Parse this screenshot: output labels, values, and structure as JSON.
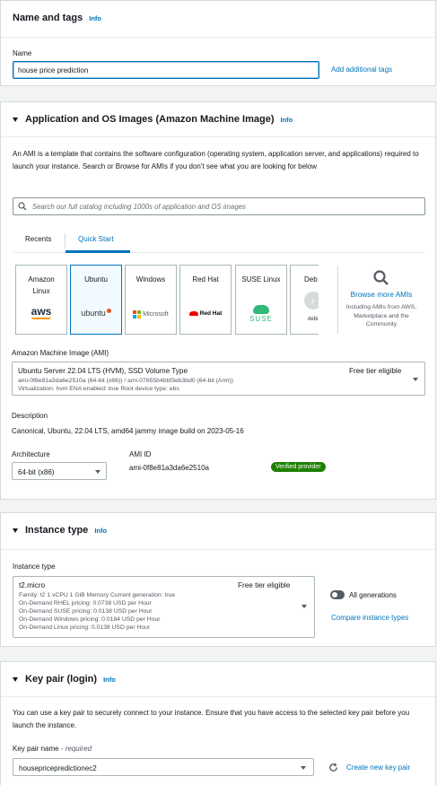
{
  "name_tags": {
    "title": "Name and tags",
    "info": "Info",
    "name_label": "Name",
    "name_value": "house price prediction",
    "add_tags_link": "Add additional tags"
  },
  "app_os": {
    "title": "Application and OS Images (Amazon Machine Image)",
    "info": "Info",
    "description": "An AMI is a template that contains the software configuration (operating system, application server, and applications) required to launch your instance. Search or Browse for AMIs if you don't see what you are looking for below",
    "search_placeholder": "Search our full catalog including 1000s of application and OS images",
    "tabs": [
      "Recents",
      "Quick Start"
    ],
    "cards": [
      {
        "name": "Amazon Linux",
        "logo": "aws"
      },
      {
        "name": "Ubuntu",
        "logo": "ubuntu"
      },
      {
        "name": "Windows",
        "logo": "Microsoft"
      },
      {
        "name": "Red Hat",
        "logo": "Red Hat"
      },
      {
        "name": "SUSE Linux",
        "logo": "SUSE"
      },
      {
        "name": "Deb",
        "logo": "debi"
      }
    ],
    "browse_more": "Browse more AMIs",
    "browse_sub": "Including AMIs from AWS, Marketplace and the Community",
    "ami_label": "Amazon Machine Image (AMI)",
    "ami_name": "Ubuntu Server 22.04 LTS (HVM), SSD Volume Type",
    "ami_ids": "ami-0f8e81a3da6e2510a (64-bit (x86)) / ami-07655b4bbf3eb3bd0 (64-bit (Arm))",
    "ami_meta": "Virtualization: hvm    ENA enabled: true    Root device type: ebs",
    "free_tier": "Free tier eligible",
    "desc_label": "Description",
    "desc_value": "Canonical, Ubuntu, 22.04 LTS, amd64 jammy image build on 2023-05-16",
    "arch_label": "Architecture",
    "arch_value": "64-bit (x86)",
    "ami_id_label": "AMI ID",
    "ami_id_value": "ami-0f8e81a3da6e2510a",
    "verified": "Verified provider"
  },
  "instance": {
    "title": "Instance type",
    "info": "Info",
    "label": "Instance type",
    "type": "t2.micro",
    "free_tier": "Free tier eligible",
    "family": "Family: t2    1 vCPU    1 GiB Memory    Current generation: true",
    "rhel": "On-Demand RHEL pricing: 0.0738 USD per Hour",
    "suse": "On-Demand SUSE pricing: 0.0138 USD per Hour",
    "windows": "On-Demand Windows pricing: 0.0184 USD per Hour",
    "linux": "On-Demand Linux pricing: 0.0138 USD per Hour",
    "all_generations": "All generations",
    "compare_link": "Compare instance types"
  },
  "keypair": {
    "title": "Key pair (login)",
    "info": "Info",
    "description": "You can use a key pair to securely connect to your instance. Ensure that you have access to the selected key pair before you launch the instance.",
    "label": "Key pair name",
    "required": " - required",
    "value": "housepricepredictionec2",
    "create_link": "Create new key pair"
  },
  "colors": {
    "link": "#0073bb",
    "border": "#aab7b8",
    "verified_badge": "#1d8102"
  }
}
